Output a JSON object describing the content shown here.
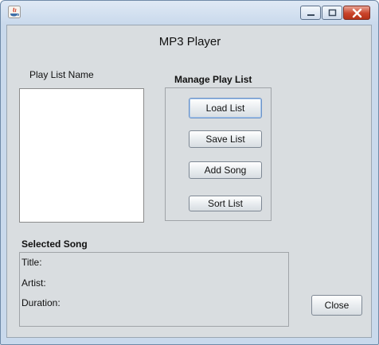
{
  "window": {
    "controls": {
      "minimize_icon": "minimize-icon",
      "maximize_icon": "maximize-icon",
      "close_icon": "close-x-icon"
    }
  },
  "app": {
    "title": "MP3 Player"
  },
  "playlist": {
    "label": "Play List Name"
  },
  "manage": {
    "heading": "Manage Play List",
    "buttons": {
      "load": "Load List",
      "save": "Save List",
      "add": "Add Song",
      "sort": "Sort List"
    }
  },
  "selected": {
    "heading": "Selected Song",
    "title_label": "Title:",
    "artist_label": "Artist:",
    "duration_label": "Duration:"
  },
  "footer": {
    "close_label": "Close"
  },
  "colors": {
    "background": "#d9dde0",
    "titlebar": "#c9d9ec",
    "close_button": "#c9432a"
  }
}
